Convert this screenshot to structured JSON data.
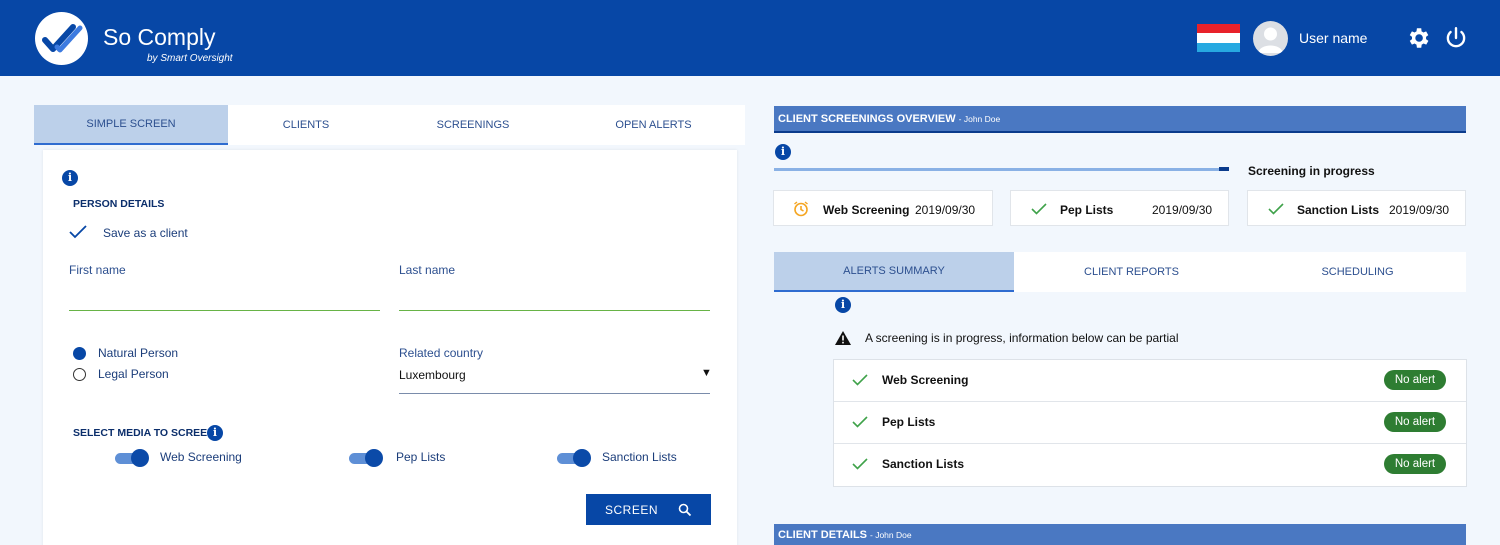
{
  "app": {
    "brand_so": "So",
    "brand_name": "Comply",
    "brand_sub": "by Smart Oversight",
    "username": "User name",
    "flag_colors": [
      "#e8222a",
      "#ffffff",
      "#27a9e1"
    ]
  },
  "left_tabs": [
    {
      "label": "SIMPLE SCREEN",
      "active": true
    },
    {
      "label": "CLIENTS",
      "active": false
    },
    {
      "label": "SCREENINGS",
      "active": false
    },
    {
      "label": "OPEN ALERTS",
      "active": false
    }
  ],
  "form": {
    "info": "i",
    "person_details": "PERSON DETAILS",
    "save_as_client": "Save as a client",
    "first_name_label": "First name",
    "first_name_value": "",
    "last_name_label": "Last name",
    "last_name_value": "",
    "natural_person": "Natural Person",
    "legal_person": "Legal Person",
    "related_country_label": "Related country",
    "related_country_value": "Luxembourg",
    "dropdown_arrow": "▼",
    "select_media": "SELECT MEDIA TO SCREEN",
    "media": [
      "Web Screening",
      "Pep Lists",
      "Sanction Lists"
    ],
    "screen_button": "SCREEN"
  },
  "overview": {
    "title": "CLIENT SCREENINGS OVERVIEW",
    "client": "- John Doe",
    "info": "i",
    "status": "Screening in progress",
    "cards": [
      {
        "name": "Web Screening",
        "date": "2019/09/30",
        "state": "pending"
      },
      {
        "name": "Pep Lists",
        "date": "2019/09/30",
        "state": "done"
      },
      {
        "name": "Sanction Lists",
        "date": "2019/09/30",
        "state": "done"
      }
    ]
  },
  "right_tabs": [
    {
      "label": "ALERTS SUMMARY",
      "active": true
    },
    {
      "label": "CLIENT REPORTS",
      "active": false
    },
    {
      "label": "SCHEDULING",
      "active": false
    }
  ],
  "alerts": {
    "info": "i",
    "warning": "A screening is in progress, information below can be partial",
    "rows": [
      {
        "name": "Web Screening",
        "badge": "No alert"
      },
      {
        "name": "Pep Lists",
        "badge": "No alert"
      },
      {
        "name": "Sanction Lists",
        "badge": "No alert"
      }
    ]
  },
  "client_details": {
    "title": "CLIENT DETAILS",
    "client": "- John Doe"
  },
  "colors": {
    "primary": "#0747a6",
    "header_bar": "#4a78c2",
    "active_tab": "#bcd0ea",
    "success": "#2e7d32",
    "check": "#3fa24a",
    "pending": "#f5a623"
  }
}
